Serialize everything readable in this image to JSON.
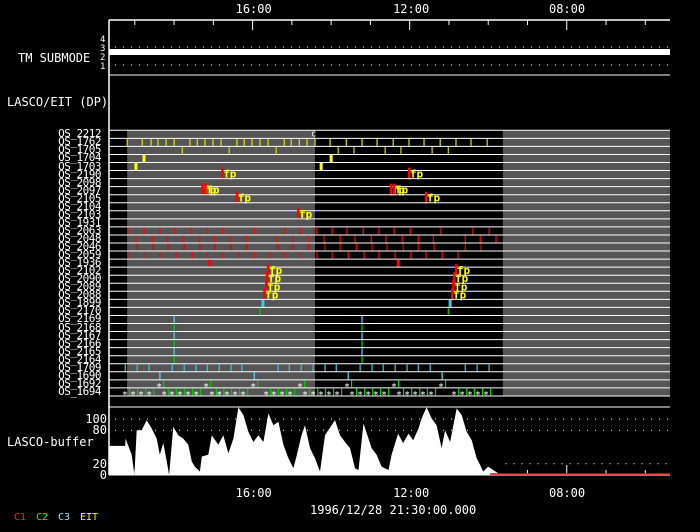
{
  "axis": {
    "unit": "hours from left edge of plot",
    "range_h": [
      0,
      14.57
    ],
    "minor_step_h": 1.02,
    "ticks": [
      {
        "label": "16:00",
        "h": 3.73
      },
      {
        "label": "12:00",
        "h": 7.82
      },
      {
        "label": "08:00",
        "h": 11.87
      }
    ]
  },
  "date_label": "1996/12/28 21:30:00.000",
  "tm_submode": {
    "title": "TM SUBMODE",
    "levels": [
      "4",
      "3",
      "2",
      "1"
    ],
    "current_level": 3
  },
  "lasco_eit_dp": {
    "title": "LASCO/EIT (DP)"
  },
  "shaded_intervals_h": [
    [
      0.47,
      5.35
    ],
    [
      10.23,
      14.57
    ]
  ],
  "legend": [
    {
      "label": "C1",
      "color": "#ff2020"
    },
    {
      "label": "C2",
      "color": "#20ff20"
    },
    {
      "label": "C3",
      "color": "#a0e0ff"
    },
    {
      "label": "EIT",
      "color": "#ffff00"
    }
  ],
  "chart_data": [
    {
      "type": "timeline",
      "title": "LASCO/EIT observing sequences",
      "rows": [
        {
          "label": "OS_2212",
          "marks": [
            {
              "h": 5.3,
              "kind": "text",
              "text": "c",
              "color": "#ffffff"
            }
          ]
        },
        {
          "label": "OS_1762",
          "color": "#e0e000",
          "ticks": [
            0.47,
            0.86,
            1.09,
            1.27,
            1.48,
            1.69,
            2.1,
            2.29,
            2.49,
            2.7,
            2.91,
            3.32,
            3.51,
            3.71,
            3.92,
            4.13,
            4.55,
            4.73,
            4.94,
            5.14,
            5.35,
            5.74,
            6.16,
            6.57,
            6.96,
            7.38,
            7.79,
            8.18,
            8.6,
            9.01,
            9.4,
            9.82
          ]
        },
        {
          "label": "OS_1705",
          "color": "#d8d800",
          "ticks": [
            1.9,
            3.12,
            4.34,
            5.95,
            6.36,
            7.17,
            7.58,
            8.39,
            8.81
          ]
        },
        {
          "label": "OS_1704",
          "color": "#ffff00",
          "thick": true,
          "ticks": [
            0.91,
            5.77
          ]
        },
        {
          "label": "OS_1703",
          "color": "#ffff00",
          "thick": true,
          "ticks": [
            0.7,
            5.51
          ]
        },
        {
          "label": "OS_2190",
          "fp": [
            2.94,
            7.79
          ]
        },
        {
          "label": "OS_2098"
        },
        {
          "label": "OS_2097",
          "fp": [
            2.42,
            2.5,
            7.32,
            7.4
          ]
        },
        {
          "label": "OS_2105",
          "fp": [
            3.32,
            8.23
          ]
        },
        {
          "label": "OS_2104"
        },
        {
          "label": "OS_2103",
          "fp": [
            4.91
          ]
        },
        {
          "label": "OS_1931"
        },
        {
          "label": "OS_2063",
          "color": "#ff0000",
          "ticks": [
            0.49,
            0.91,
            1.32,
            1.71,
            2.13,
            2.55,
            2.94,
            3.77,
            4.57,
            4.96,
            5.38,
            5.79,
            6.18,
            6.6,
            7.01,
            7.4,
            7.82,
            8.62,
            9.45,
            9.87
          ]
        },
        {
          "label": "OS_2048",
          "color": "#ff0000",
          "ticks": [
            0.7,
            1.12,
            1.51,
            1.92,
            2.34,
            2.73,
            3.14,
            3.56,
            4.36,
            4.78,
            5.17,
            5.58,
            6.0,
            6.39,
            6.81,
            7.19,
            7.61,
            8.03,
            8.42,
            9.25,
            9.64,
            10.05
          ]
        },
        {
          "label": "OS_2046",
          "color": "#e00000",
          "ticks": [
            0.73,
            1.14,
            1.53,
            1.95,
            2.36,
            2.75,
            3.17,
            3.58,
            4.39,
            4.78,
            5.19,
            5.61,
            6.0,
            6.42,
            6.83,
            7.22,
            7.64,
            8.03,
            8.44,
            9.25,
            9.66
          ]
        },
        {
          "label": "OS_2059",
          "color": "#ff0000",
          "ticks": [
            0.52,
            0.94,
            1.32,
            1.74,
            2.16,
            2.55,
            2.96,
            3.38,
            3.77,
            4.18,
            4.57,
            4.99,
            5.4,
            5.79,
            6.21,
            6.62,
            7.01,
            7.43,
            7.84,
            8.23,
            8.65,
            9.06
          ]
        },
        {
          "label": "OS_1936",
          "color": "#ff0000",
          "thick": true,
          "ticks": [
            2.62,
            7.51
          ]
        },
        {
          "label": "OS_2102",
          "fp": [
            4.13,
            9.01
          ]
        },
        {
          "label": "OS_2090",
          "fp": [
            4.1,
            8.96
          ]
        },
        {
          "label": "OS_2089",
          "fp": [
            4.08,
            8.94
          ]
        },
        {
          "label": "OS_2088",
          "fp": [
            4.03,
            8.91
          ]
        },
        {
          "label": "OS_1899",
          "color": "#40c8e8",
          "thick": true,
          "ticks": [
            4.0,
            8.86
          ]
        },
        {
          "label": "OS_2170",
          "color": "#00d000",
          "ticks": [
            3.92,
            8.81
          ]
        },
        {
          "label": "OS_2169",
          "color": "#60d0f0",
          "ticks": [
            1.69,
            6.57
          ]
        },
        {
          "label": "OS_2168",
          "color": "#00d000",
          "ticks": [
            1.69,
            6.57
          ]
        },
        {
          "label": "OS_2167",
          "color": "#60d0f0",
          "ticks": [
            1.69,
            6.57
          ]
        },
        {
          "label": "OS_2166",
          "color": "#00d000",
          "ticks": [
            1.69,
            6.57
          ]
        },
        {
          "label": "OS_2165",
          "color": "#60d0f0",
          "ticks": [
            1.69,
            6.57
          ]
        },
        {
          "label": "OS_2164",
          "color": "#00d000",
          "ticks": [
            1.69,
            6.57
          ]
        },
        {
          "label": "OS_1709",
          "color": "#40c0e0",
          "ticks": [
            0.42,
            0.73,
            1.04,
            1.64,
            1.95,
            2.26,
            2.55,
            2.86,
            3.17,
            3.45,
            4.39,
            4.68,
            4.99,
            5.3,
            5.61,
            5.9,
            6.52,
            6.83,
            7.12,
            7.43,
            7.74,
            8.03,
            8.34,
            9.25,
            9.56,
            9.87
          ]
        },
        {
          "label": "OS_1690",
          "color": "#60d8ff",
          "ticks": [
            1.32,
            3.77,
            6.21,
            8.65
          ]
        },
        {
          "label": "OS_1692",
          "color": "#00d000",
          "stars": [
            1.38,
            2.6,
            3.82,
            5.04,
            6.26,
            7.48,
            8.7
          ]
        },
        {
          "label": "OS_1694",
          "color": "#00d000",
          "stars": [
            0.49,
            0.7,
            0.91,
            1.12,
            1.51,
            1.71,
            1.92,
            2.13,
            2.34,
            2.75,
            2.94,
            3.14,
            3.35,
            3.56,
            4.16,
            4.36,
            4.57,
            4.78,
            5.17,
            5.38,
            5.58,
            5.79,
            6.0,
            6.39,
            6.6,
            6.81,
            7.01,
            7.22,
            7.61,
            7.82,
            8.03,
            8.23,
            8.44,
            9.04,
            9.25,
            9.45,
            9.66,
            9.87
          ]
        }
      ],
      "fp_label": "fp"
    },
    {
      "type": "area",
      "title": "LASCO-buffer",
      "yticks": [
        "100",
        "80",
        "20",
        "0"
      ],
      "ytick_values": [
        100,
        80,
        20,
        0
      ],
      "ylim": [
        0,
        121
      ],
      "points": [
        [
          0,
          52
        ],
        [
          0.42,
          52
        ],
        [
          0.43,
          65
        ],
        [
          0.59,
          36
        ],
        [
          0.66,
          0
        ],
        [
          0.72,
          80
        ],
        [
          0.85,
          80
        ],
        [
          0.98,
          98
        ],
        [
          1.11,
          83
        ],
        [
          1.24,
          65
        ],
        [
          1.32,
          36
        ],
        [
          1.41,
          57
        ],
        [
          1.5,
          24
        ],
        [
          1.56,
          0
        ],
        [
          1.67,
          86
        ],
        [
          1.8,
          71
        ],
        [
          1.93,
          65
        ],
        [
          2.06,
          54
        ],
        [
          2.15,
          24
        ],
        [
          2.23,
          15
        ],
        [
          2.36,
          6
        ],
        [
          2.41,
          33
        ],
        [
          2.58,
          36
        ],
        [
          2.67,
          71
        ],
        [
          2.84,
          54
        ],
        [
          2.97,
          71
        ],
        [
          3.1,
          39
        ],
        [
          3.23,
          65
        ],
        [
          3.36,
          121
        ],
        [
          3.49,
          107
        ],
        [
          3.62,
          77
        ],
        [
          3.75,
          59
        ],
        [
          3.88,
          71
        ],
        [
          4.01,
          59
        ],
        [
          4.14,
          110
        ],
        [
          4.27,
          89
        ],
        [
          4.4,
          95
        ],
        [
          4.53,
          54
        ],
        [
          4.66,
          30
        ],
        [
          4.79,
          12
        ],
        [
          4.88,
          36
        ],
        [
          5.0,
          71
        ],
        [
          5.09,
          89
        ],
        [
          5.22,
          48
        ],
        [
          5.35,
          30
        ],
        [
          5.48,
          6
        ],
        [
          5.61,
          71
        ],
        [
          5.87,
          98
        ],
        [
          6.0,
          71
        ],
        [
          6.13,
          59
        ],
        [
          6.26,
          48
        ],
        [
          6.39,
          12
        ],
        [
          6.48,
          9
        ],
        [
          6.61,
          92
        ],
        [
          6.74,
          65
        ],
        [
          6.82,
          48
        ],
        [
          6.95,
          36
        ],
        [
          7.08,
          15
        ],
        [
          7.26,
          9
        ],
        [
          7.34,
          36
        ],
        [
          7.51,
          74
        ],
        [
          7.64,
          57
        ],
        [
          7.78,
          74
        ],
        [
          7.9,
          62
        ],
        [
          8.04,
          83
        ],
        [
          8.12,
          101
        ],
        [
          8.25,
          121
        ],
        [
          8.38,
          101
        ],
        [
          8.51,
          89
        ],
        [
          8.64,
          48
        ],
        [
          8.73,
          80
        ],
        [
          8.86,
          59
        ],
        [
          9.03,
          119
        ],
        [
          9.16,
          107
        ],
        [
          9.29,
          77
        ],
        [
          9.42,
          62
        ],
        [
          9.55,
          30
        ],
        [
          9.64,
          18
        ],
        [
          9.72,
          6
        ],
        [
          9.85,
          15
        ],
        [
          9.98,
          9
        ],
        [
          10.11,
          3
        ],
        [
          10.24,
          0
        ]
      ]
    }
  ]
}
